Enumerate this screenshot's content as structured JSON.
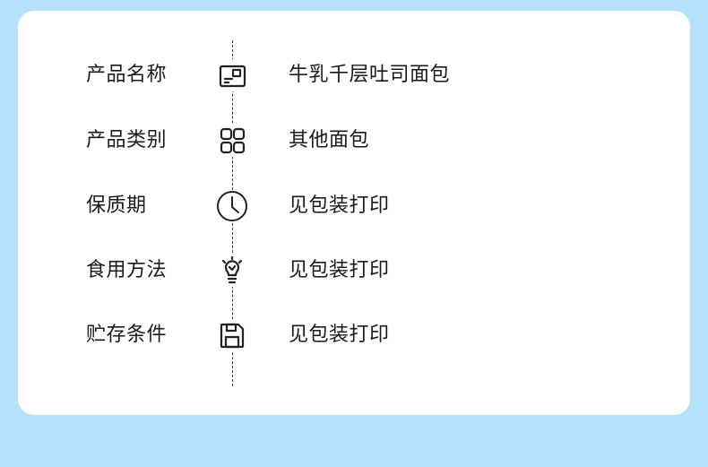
{
  "info_rows": [
    {
      "label": "产品名称",
      "value": "牛乳千层吐司面包",
      "icon": "id-card-icon"
    },
    {
      "label": "产品类别",
      "value": "其他面包",
      "icon": "category-grid-icon"
    },
    {
      "label": "保质期",
      "value": "见包装打印",
      "icon": "clock-icon"
    },
    {
      "label": "食用方法",
      "value": "见包装打印",
      "icon": "lightbulb-icon"
    },
    {
      "label": "贮存条件",
      "value": "见包装打印",
      "icon": "save-icon"
    }
  ],
  "colors": {
    "background": "#b5e1fb",
    "card": "#ffffff",
    "text": "#1a1a1a"
  }
}
